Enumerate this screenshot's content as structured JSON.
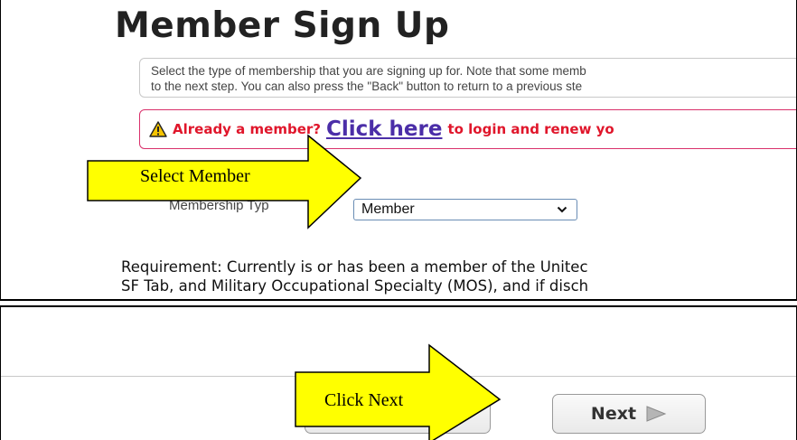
{
  "page": {
    "title": "Member Sign Up",
    "intro_line1": "Select the type of membership that you are signing up for. Note that some memb",
    "intro_line2": "to the next step. You can also press the \"Back\" button to return to a previous ste",
    "alert": {
      "before": "Already a m",
      "after_arrow": "ember?",
      "link": "Click here",
      "after": "to login and renew yo"
    },
    "membership_label": "Membership Typ",
    "membership_value": "Member",
    "requirement_line1": "Requirement: Currently is or has been a member of the Unitec",
    "requirement_line2": "SF Tab, and Military Occupational Specialty (MOS), and if disch"
  },
  "nav": {
    "next_label": "Next"
  },
  "annotations": {
    "select_member": "Select Member",
    "click_next": "Click Next"
  },
  "colors": {
    "alert_text": "#e0162b",
    "alert_border": "#d9306b",
    "link": "#4b2ea8",
    "callout_fill": "#ffff00",
    "warning_icon": "#f5c400"
  },
  "icons": {
    "alert": "warning-triangle-icon",
    "select": "chevron-down-icon",
    "next": "play-triangle-icon"
  }
}
